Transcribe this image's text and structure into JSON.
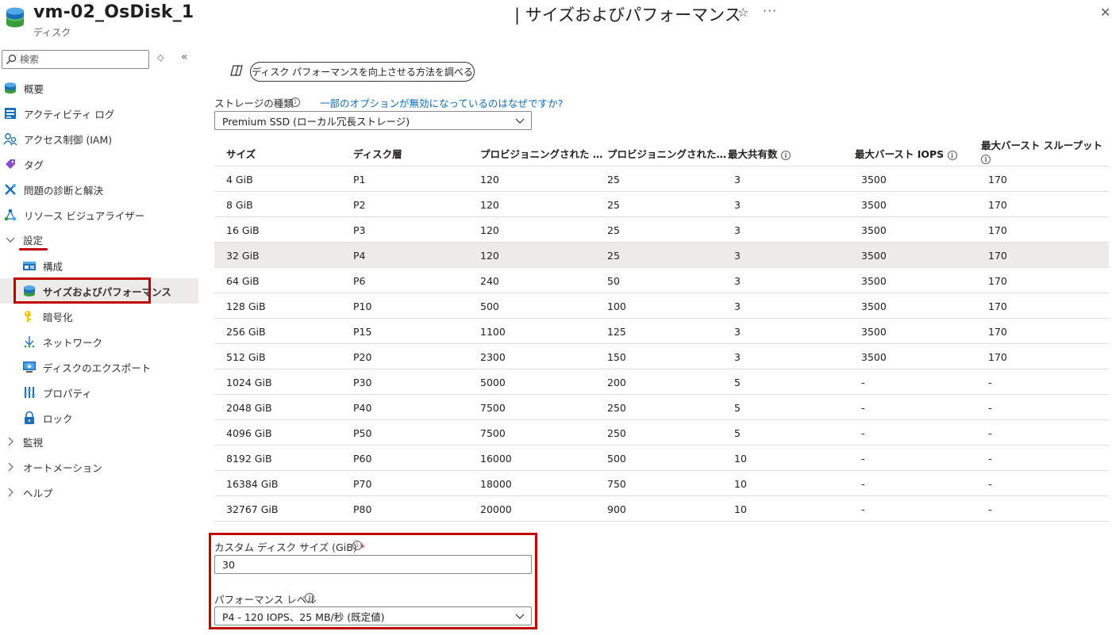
{
  "header": {
    "title": "vm-02_OsDisk_1",
    "subtitle": "ディスク",
    "blade_title": "| サイズおよびパフォーマンス",
    "star_glyph": "☆",
    "more_glyph": "···",
    "close_glyph": "✕"
  },
  "sidebar": {
    "search_placeholder": "検索",
    "updown_glyph": "◇",
    "collapse_glyph": "«",
    "items": [
      {
        "label": "概要",
        "icon": "disk-icon"
      },
      {
        "label": "アクティビティ ログ",
        "icon": "activity-log-icon"
      },
      {
        "label": "アクセス制御 (IAM)",
        "icon": "iam-icon"
      },
      {
        "label": "タグ",
        "icon": "tag-icon"
      },
      {
        "label": "問題の診断と解決",
        "icon": "wrench-icon"
      },
      {
        "label": "リソース ビジュアライザー",
        "icon": "visualizer-icon"
      }
    ],
    "settings": {
      "label": "設定",
      "children": [
        {
          "label": "構成",
          "icon": "config-icon"
        },
        {
          "label": "サイズおよびパフォーマンス",
          "icon": "disk-icon",
          "selected": true
        },
        {
          "label": "暗号化",
          "icon": "key-icon"
        },
        {
          "label": "ネットワーク",
          "icon": "network-icon"
        },
        {
          "label": "ディスクのエクスポート",
          "icon": "export-icon"
        },
        {
          "label": "プロパティ",
          "icon": "properties-icon"
        },
        {
          "label": "ロック",
          "icon": "lock-icon"
        }
      ]
    },
    "groups": [
      {
        "label": "監視"
      },
      {
        "label": "オートメーション"
      },
      {
        "label": "ヘルプ"
      }
    ]
  },
  "main": {
    "learn_button": "ディスク パフォーマンスを向上させる方法を調べる",
    "storage_label": "ストレージの種類",
    "why_link": "一部のオプションが無効になっているのはなぜですか?",
    "storage_value": "Premium SSD (ローカル冗長ストレージ)",
    "table": {
      "headers": [
        "サイズ",
        "ディスク層",
        "プロビジョニングされた …",
        "プロビジョニングされた…",
        "最大共有数",
        "最大バースト IOPS",
        "最大バースト スループット"
      ],
      "rows": [
        [
          "4 GiB",
          "P1",
          "120",
          "25",
          "3",
          "3500",
          "170"
        ],
        [
          "8 GiB",
          "P2",
          "120",
          "25",
          "3",
          "3500",
          "170"
        ],
        [
          "16 GiB",
          "P3",
          "120",
          "25",
          "3",
          "3500",
          "170"
        ],
        [
          "32 GiB",
          "P4",
          "120",
          "25",
          "3",
          "3500",
          "170"
        ],
        [
          "64 GiB",
          "P6",
          "240",
          "50",
          "3",
          "3500",
          "170"
        ],
        [
          "128 GiB",
          "P10",
          "500",
          "100",
          "3",
          "3500",
          "170"
        ],
        [
          "256 GiB",
          "P15",
          "1100",
          "125",
          "3",
          "3500",
          "170"
        ],
        [
          "512 GiB",
          "P20",
          "2300",
          "150",
          "3",
          "3500",
          "170"
        ],
        [
          "1024 GiB",
          "P30",
          "5000",
          "200",
          "5",
          "-",
          "-"
        ],
        [
          "2048 GiB",
          "P40",
          "7500",
          "250",
          "5",
          "-",
          "-"
        ],
        [
          "4096 GiB",
          "P50",
          "7500",
          "250",
          "5",
          "-",
          "-"
        ],
        [
          "8192 GiB",
          "P60",
          "16000",
          "500",
          "10",
          "-",
          "-"
        ],
        [
          "16384 GiB",
          "P70",
          "18000",
          "750",
          "10",
          "-",
          "-"
        ],
        [
          "32767 GiB",
          "P80",
          "20000",
          "900",
          "10",
          "-",
          "-"
        ]
      ],
      "selected_row": 3
    },
    "custom_size_label": "カスタム ディスク サイズ (GiB)",
    "required_mark": "*",
    "custom_size_value": "30",
    "perf_label": "パフォーマンス レベル",
    "perf_value": "P4 - 120 IOPS、25 MB/秒 (既定値)",
    "info_glyph": "i"
  },
  "colors": {
    "highlight_red": "#c00000",
    "link_blue": "#0f6cbd",
    "selected_bg": "#edebe9"
  }
}
